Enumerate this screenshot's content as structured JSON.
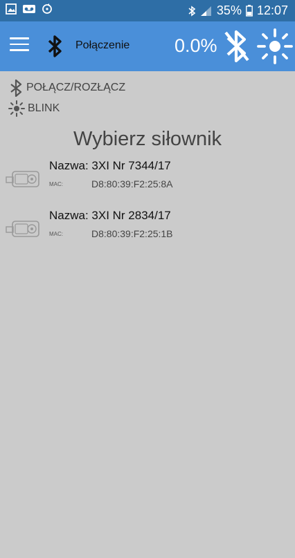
{
  "status_bar": {
    "battery": "35%",
    "time": "12:07",
    "icons": [
      "image-icon",
      "voicemail-icon",
      "sync-icon",
      "bluetooth-icon",
      "signal-icon",
      "battery-icon"
    ]
  },
  "app_bar": {
    "title": "Połączenie",
    "progress": "0.0%",
    "icons": [
      "menu-icon",
      "bluetooth-icon",
      "bluetooth-disabled-icon",
      "brightness-icon"
    ]
  },
  "actions": {
    "connect_label": "POŁĄCZ/ROZŁĄCZ",
    "blink_label": "BLINK"
  },
  "main": {
    "heading": "Wybierz siłownik",
    "devices": [
      {
        "name": "Nazwa: 3XI Nr 7344/17",
        "mac_label": "MAC:",
        "mac": "D8:80:39:F2:25:8A"
      },
      {
        "name": "Nazwa: 3XI Nr 2834/17",
        "mac_label": "MAC:",
        "mac": "D8:80:39:F2:25:1B"
      }
    ]
  },
  "colors": {
    "status_bar": "#2e6ea6",
    "app_bar": "#4a8fd9",
    "background": "#cbcbcb"
  }
}
